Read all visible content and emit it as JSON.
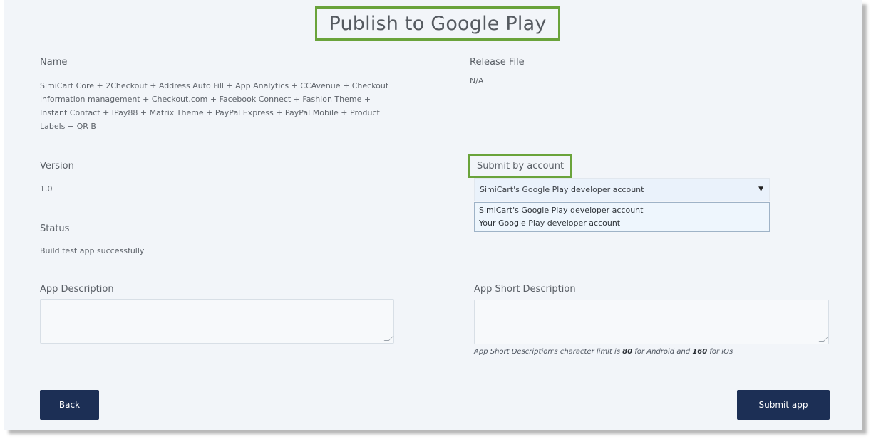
{
  "title": "Publish to Google Play",
  "left": {
    "name_label": "Name",
    "name_value": "SimiCart Core + 2Checkout + Address Auto Fill + App Analytics + CCAvenue + Checkout information management + Checkout.com + Facebook Connect + Fashion Theme + Instant Contact + IPay88 + Matrix Theme + PayPal Express + PayPal Mobile + Product Labels + QR B",
    "version_label": "Version",
    "version_value": "1.0",
    "status_label": "Status",
    "status_value": "Build test app successfully",
    "app_description_label": "App Description",
    "app_description_value": ""
  },
  "right": {
    "release_file_label": "Release File",
    "release_file_value": "N/A",
    "submit_by_label": "Submit by account",
    "submit_by_selected": "SimiCart's Google Play developer account",
    "submit_by_options": [
      "SimiCart's Google Play developer account",
      "Your Google Play developer account"
    ],
    "short_description_label": "App Short Description",
    "short_description_value": "",
    "help": {
      "part1": "App Short Description's character limit is ",
      "android_limit": "80",
      "part2": " for Android and ",
      "ios_limit": "160",
      "part3": " for iOs"
    }
  },
  "buttons": {
    "back": "Back",
    "submit": "Submit app"
  },
  "colors": {
    "highlight_border": "#6aa33b",
    "button_bg": "#1c2f55",
    "panel_bg": "#f2f5f9"
  }
}
